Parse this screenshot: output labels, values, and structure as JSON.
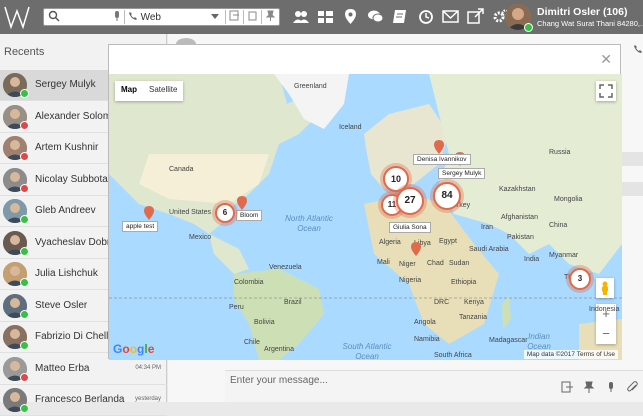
{
  "search": {
    "scope": "Web"
  },
  "profile": {
    "name": "Dimitri Osler (106)",
    "location": "Chang Wat Surat Thani 84280,..."
  },
  "sidebar": {
    "title": "Recents",
    "contacts": [
      {
        "name": "Sergey Mulyk",
        "status": "#35c141",
        "time": ""
      },
      {
        "name": "Alexander Solome",
        "status": "#e04848",
        "time": ""
      },
      {
        "name": "Artem Kushnir",
        "status": "#e04848",
        "time": ""
      },
      {
        "name": "Nicolay Subbota",
        "status": "#e04848",
        "time": ""
      },
      {
        "name": "Gleb Andreev",
        "status": "#35c141",
        "time": ""
      },
      {
        "name": "Vyacheslav Dobre",
        "status": "#35c141",
        "time": ""
      },
      {
        "name": "Julia Lishchuk",
        "status": "#35c141",
        "time": ""
      },
      {
        "name": "Steve Osler",
        "status": "#35c141",
        "time": ""
      },
      {
        "name": "Fabrizio Di Chello",
        "status": "#35c141",
        "time": ""
      },
      {
        "name": "Matteo Erba",
        "status": "#e04848",
        "time": "04:34 PM"
      },
      {
        "name": "Francesco Berlanda",
        "status": "#35c141",
        "time": "yesterday"
      }
    ]
  },
  "chat": {
    "placeholder": "Enter your message..."
  },
  "map": {
    "map_label": "Map",
    "satellite_label": "Satellite",
    "clusters": [
      "6",
      "10",
      "11",
      "27",
      "84",
      "3"
    ],
    "labels": [
      "apple test",
      "Bloom",
      "Denisa Ivannikov",
      "Sergey Mulyk",
      "Giulia Sona"
    ],
    "place_names": [
      "Greenland",
      "Iceland",
      "Canada",
      "United States",
      "Mexico",
      "Venezuela",
      "Colombia",
      "Peru",
      "Brazil",
      "Bolivia",
      "Chile",
      "Argentina",
      "Algeria",
      "Libya",
      "Egypt",
      "Mali",
      "Niger",
      "Chad",
      "Sudan",
      "Nigeria",
      "Ethiopia",
      "DRC",
      "Kenya",
      "Tanzania",
      "Angola",
      "Namibia",
      "South Africa",
      "Madagascar",
      "Kazakhstan",
      "Mongolia",
      "China",
      "India",
      "Iran",
      "Saudi Arabia",
      "Turkey",
      "Russia",
      "Afghanistan",
      "Pakistan",
      "Indonesia",
      "Thailand",
      "Myanmar"
    ],
    "oceans": [
      "North Atlantic Ocean",
      "South Atlantic Ocean",
      "Indian Ocean"
    ],
    "google": "Google",
    "attribution": "Map data ©2017   Terms of Use"
  }
}
